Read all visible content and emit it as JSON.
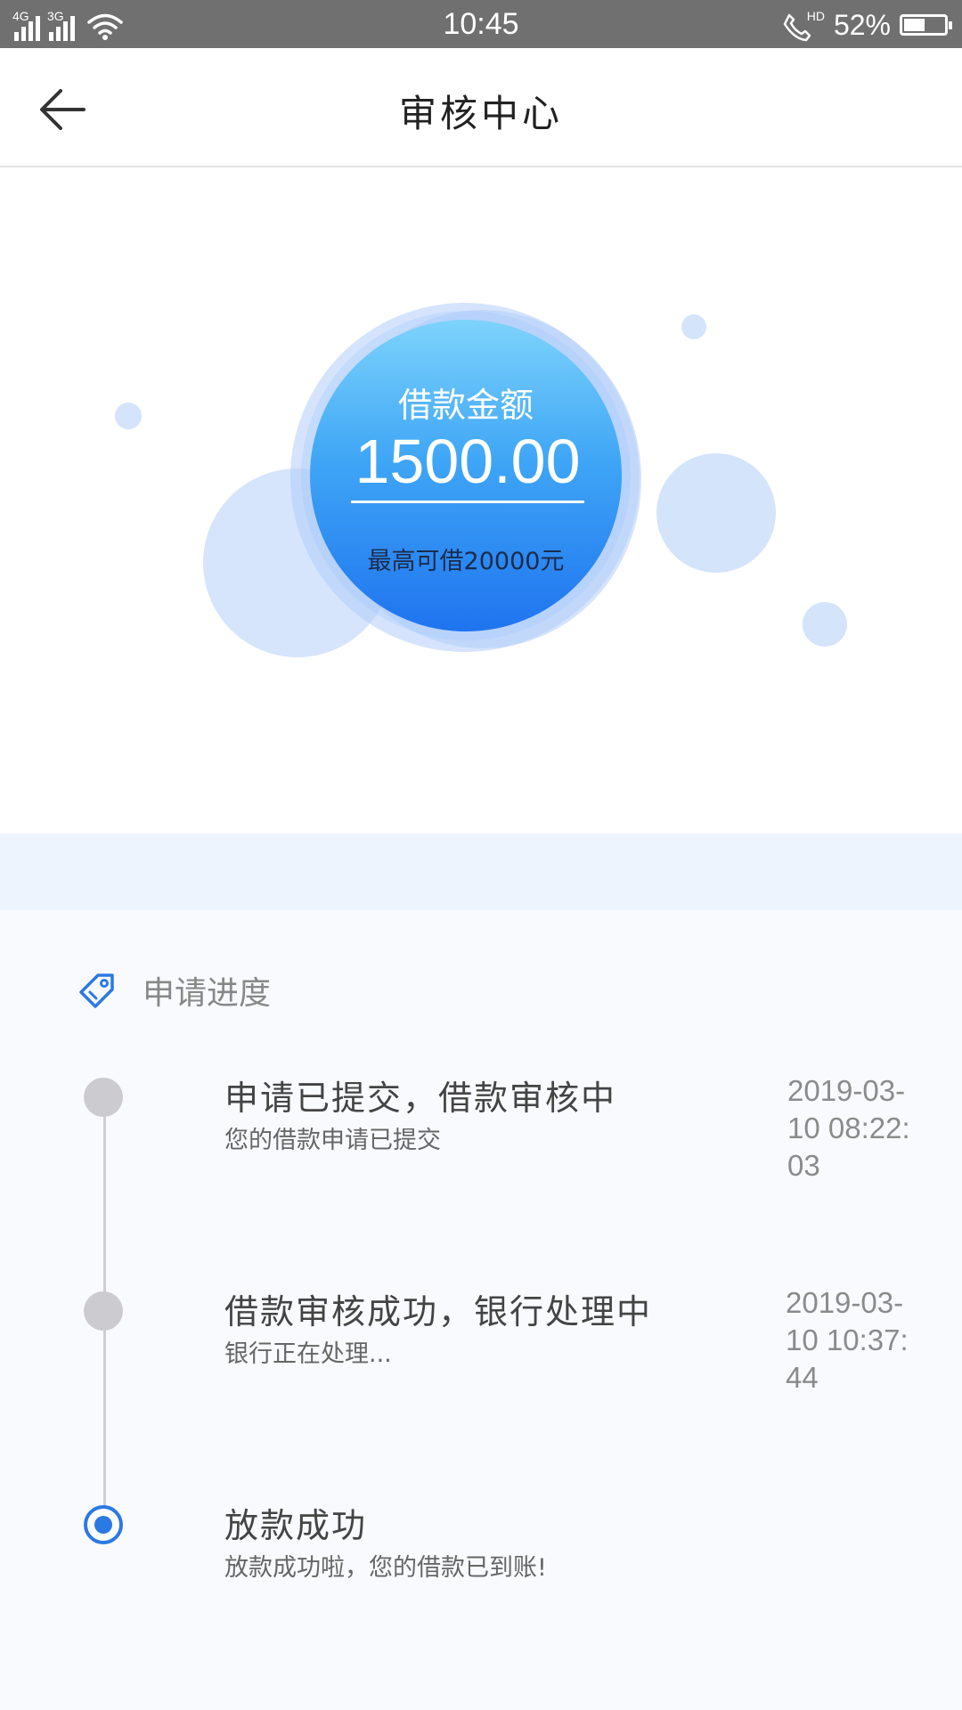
{
  "status_bar": {
    "time": "10:45",
    "network_1": "4G",
    "network_2": "3G",
    "call_badge": "HD",
    "battery_percent": "52%",
    "battery_level": 0.52
  },
  "nav": {
    "title": "审核中心"
  },
  "hero": {
    "amount_label": "借款金额",
    "amount_value": "1500.00",
    "max_text": "最高可借20000元"
  },
  "progress": {
    "section_title": "申请进度",
    "steps": [
      {
        "title": "申请已提交，借款审核中",
        "subtitle": "您的借款申请已提交",
        "time": "2019-03-10 08:22:03",
        "status": "done"
      },
      {
        "title": "借款审核成功，银行处理中",
        "subtitle": "银行正在处理...",
        "time": "2019-03-10 10:37:44",
        "status": "done"
      },
      {
        "title": "放款成功",
        "subtitle": "放款成功啦，您的借款已到账!",
        "time": "",
        "status": "current"
      }
    ]
  },
  "colors": {
    "accent": "#2b79e2",
    "status_bar": "#707070",
    "band": "#edf4fe",
    "bubble": "#d3e4fb"
  }
}
